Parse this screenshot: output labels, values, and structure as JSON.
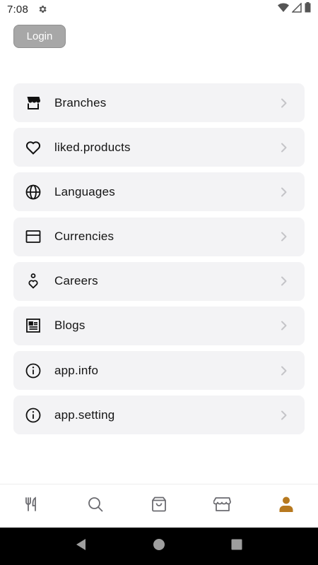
{
  "status_bar": {
    "time": "7:08"
  },
  "header": {
    "login_label": "Login"
  },
  "menu": {
    "items": [
      {
        "label": "Branches",
        "icon": "store-icon"
      },
      {
        "label": "liked.products",
        "icon": "heart-icon"
      },
      {
        "label": "Languages",
        "icon": "globe-icon"
      },
      {
        "label": "Currencies",
        "icon": "card-icon"
      },
      {
        "label": "Careers",
        "icon": "careers-icon"
      },
      {
        "label": "Blogs",
        "icon": "newspaper-icon"
      },
      {
        "label": "app.info",
        "icon": "info-icon"
      },
      {
        "label": "app.setting",
        "icon": "info-icon"
      }
    ]
  },
  "bottom_nav": {
    "items": [
      "restaurant-icon",
      "search-icon",
      "bag-icon",
      "store-icon",
      "profile-icon"
    ],
    "active_index": 4
  },
  "colors": {
    "accent": "#b7791f",
    "card_bg": "#f3f3f5",
    "login_bg": "#a7a7a7"
  }
}
